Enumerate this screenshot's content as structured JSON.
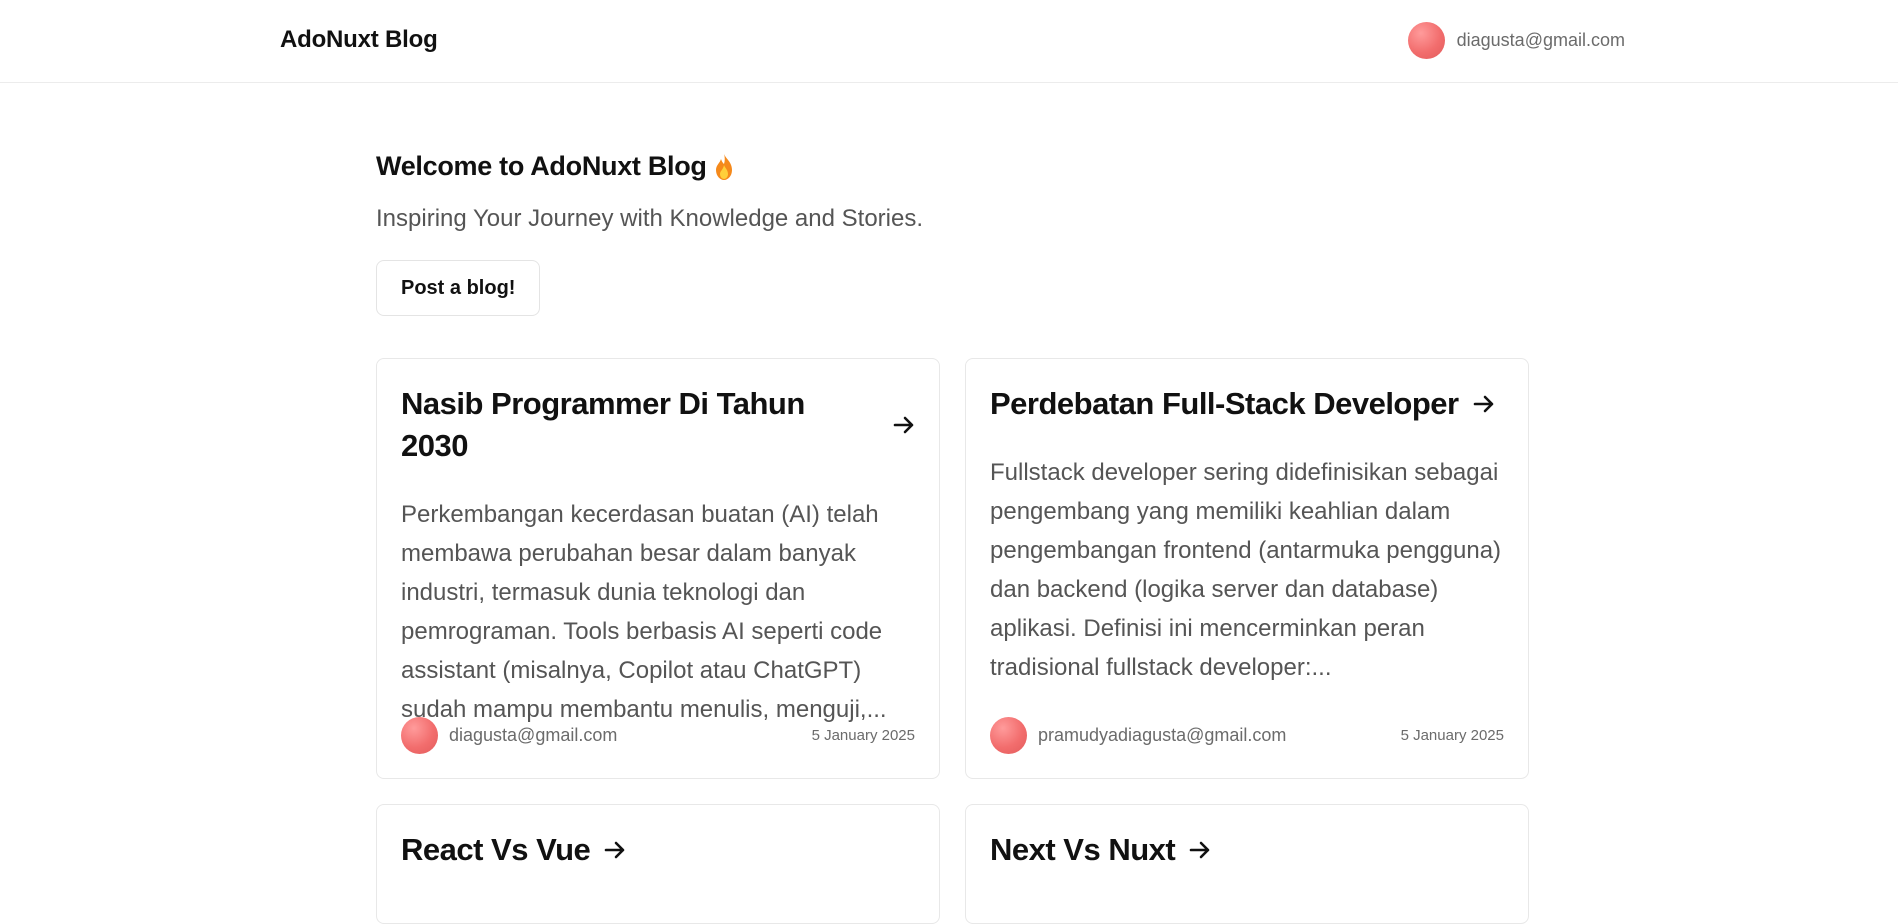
{
  "header": {
    "brand": "AdoNuxt Blog",
    "user_email": "diagusta@gmail.com"
  },
  "hero": {
    "title": "Welcome to AdoNuxt Blog",
    "title_icon": "fire-icon",
    "tagline": "Inspiring Your Journey with Knowledge and Stories.",
    "post_button": "Post a blog!"
  },
  "posts": [
    {
      "title": "Nasib Programmer Di Tahun 2030",
      "excerpt": "Perkembangan kecerdasan buatan (AI) telah membawa perubahan besar dalam banyak industri, termasuk dunia teknologi dan pemrograman. Tools berbasis AI seperti code assistant (misalnya, Copilot atau ChatGPT) sudah mampu membantu menulis, menguji,...",
      "author": "diagusta@gmail.com",
      "date": "5 January 2025"
    },
    {
      "title": "Perdebatan Full-Stack Developer",
      "excerpt": "Fullstack developer sering didefinisikan sebagai pengembang yang memiliki keahlian dalam pengembangan frontend (antarmuka pengguna) dan backend (logika server dan database) aplikasi. Definisi ini mencerminkan peran tradisional fullstack developer:...",
      "author": "pramudyadiagusta@gmail.com",
      "date": "5 January 2025"
    },
    {
      "title": "React Vs Vue"
    },
    {
      "title": "Next Vs Nuxt"
    }
  ],
  "colors": {
    "avatar": "#f26d6d",
    "border": "#e8e8e8",
    "muted_text": "#555555"
  }
}
